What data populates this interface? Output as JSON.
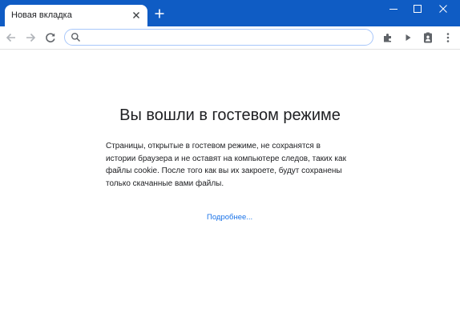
{
  "tab": {
    "title": "Новая вкладка"
  },
  "omnibox": {
    "value": "",
    "placeholder": ""
  },
  "content": {
    "heading": "Вы вошли в гостевом режиме",
    "description": "Страницы, открытые в гостевом режиме, не сохранятся в истории браузера и не оставят на компьютере следов, таких как файлы cookie. После того как вы их закроете, будут сохранены только скачанные вами файлы.",
    "link": "Подробнее..."
  },
  "colors": {
    "titlebar": "#0f5cc4",
    "link": "#1a73e8",
    "text": "#202124"
  },
  "icons": {
    "tab_close": "close-icon",
    "new_tab": "plus-icon",
    "back": "arrow-left-icon",
    "forward": "arrow-right-icon",
    "reload": "reload-icon",
    "search": "search-icon",
    "extensions": "puzzle-icon",
    "media": "play-icon",
    "profile": "guest-profile-icon",
    "menu": "kebab-menu-icon",
    "minimize": "minimize-icon",
    "maximize": "maximize-icon",
    "close": "close-window-icon"
  }
}
